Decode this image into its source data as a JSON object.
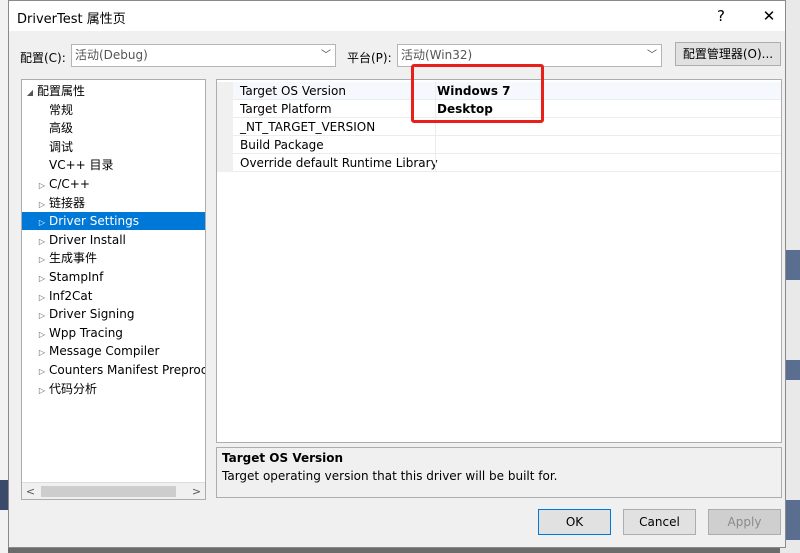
{
  "window": {
    "title": "DriverTest 属性页",
    "help_glyph": "?",
    "close_glyph": "✕"
  },
  "toolbar": {
    "config_label": "配置(C):",
    "config_value": "活动(Debug)",
    "platform_label": "平台(P):",
    "platform_value": "活动(Win32)",
    "config_manager_label": "配置管理器(O)..."
  },
  "tree": {
    "items": [
      {
        "label": "配置属性",
        "expander": "◢",
        "indent": 0,
        "selected": false
      },
      {
        "label": "常规",
        "expander": "",
        "indent": 1,
        "selected": false
      },
      {
        "label": "高级",
        "expander": "",
        "indent": 1,
        "selected": false
      },
      {
        "label": "调试",
        "expander": "",
        "indent": 1,
        "selected": false
      },
      {
        "label": "VC++ 目录",
        "expander": "",
        "indent": 1,
        "selected": false
      },
      {
        "label": "C/C++",
        "expander": "▷",
        "indent": 1,
        "selected": false
      },
      {
        "label": "链接器",
        "expander": "▷",
        "indent": 1,
        "selected": false
      },
      {
        "label": "Driver Settings",
        "expander": "▷",
        "indent": 1,
        "selected": true
      },
      {
        "label": "Driver Install",
        "expander": "▷",
        "indent": 1,
        "selected": false
      },
      {
        "label": "生成事件",
        "expander": "▷",
        "indent": 1,
        "selected": false
      },
      {
        "label": "StampInf",
        "expander": "▷",
        "indent": 1,
        "selected": false
      },
      {
        "label": "Inf2Cat",
        "expander": "▷",
        "indent": 1,
        "selected": false
      },
      {
        "label": "Driver Signing",
        "expander": "▷",
        "indent": 1,
        "selected": false
      },
      {
        "label": "Wpp Tracing",
        "expander": "▷",
        "indent": 1,
        "selected": false
      },
      {
        "label": "Message Compiler",
        "expander": "▷",
        "indent": 1,
        "selected": false
      },
      {
        "label": "Counters Manifest Preprocessor",
        "expander": "▷",
        "indent": 1,
        "selected": false
      },
      {
        "label": "代码分析",
        "expander": "▷",
        "indent": 1,
        "selected": false
      }
    ],
    "scroll_left": "<",
    "scroll_right": ">"
  },
  "properties": {
    "rows": [
      {
        "name": "Target OS Version",
        "value": "Windows 7"
      },
      {
        "name": "Target Platform",
        "value": "Desktop"
      },
      {
        "name": "_NT_TARGET_VERSION",
        "value": ""
      },
      {
        "name": "Build Package",
        "value": ""
      },
      {
        "name": "Override default Runtime Library",
        "value": ""
      }
    ]
  },
  "description": {
    "title": "Target OS Version",
    "text": "Target operating version that this driver will be built for."
  },
  "buttons": {
    "ok": "OK",
    "cancel": "Cancel",
    "apply": "Apply"
  },
  "colors": {
    "selection": "#0078d7",
    "annotation_box": "#e8201a"
  }
}
